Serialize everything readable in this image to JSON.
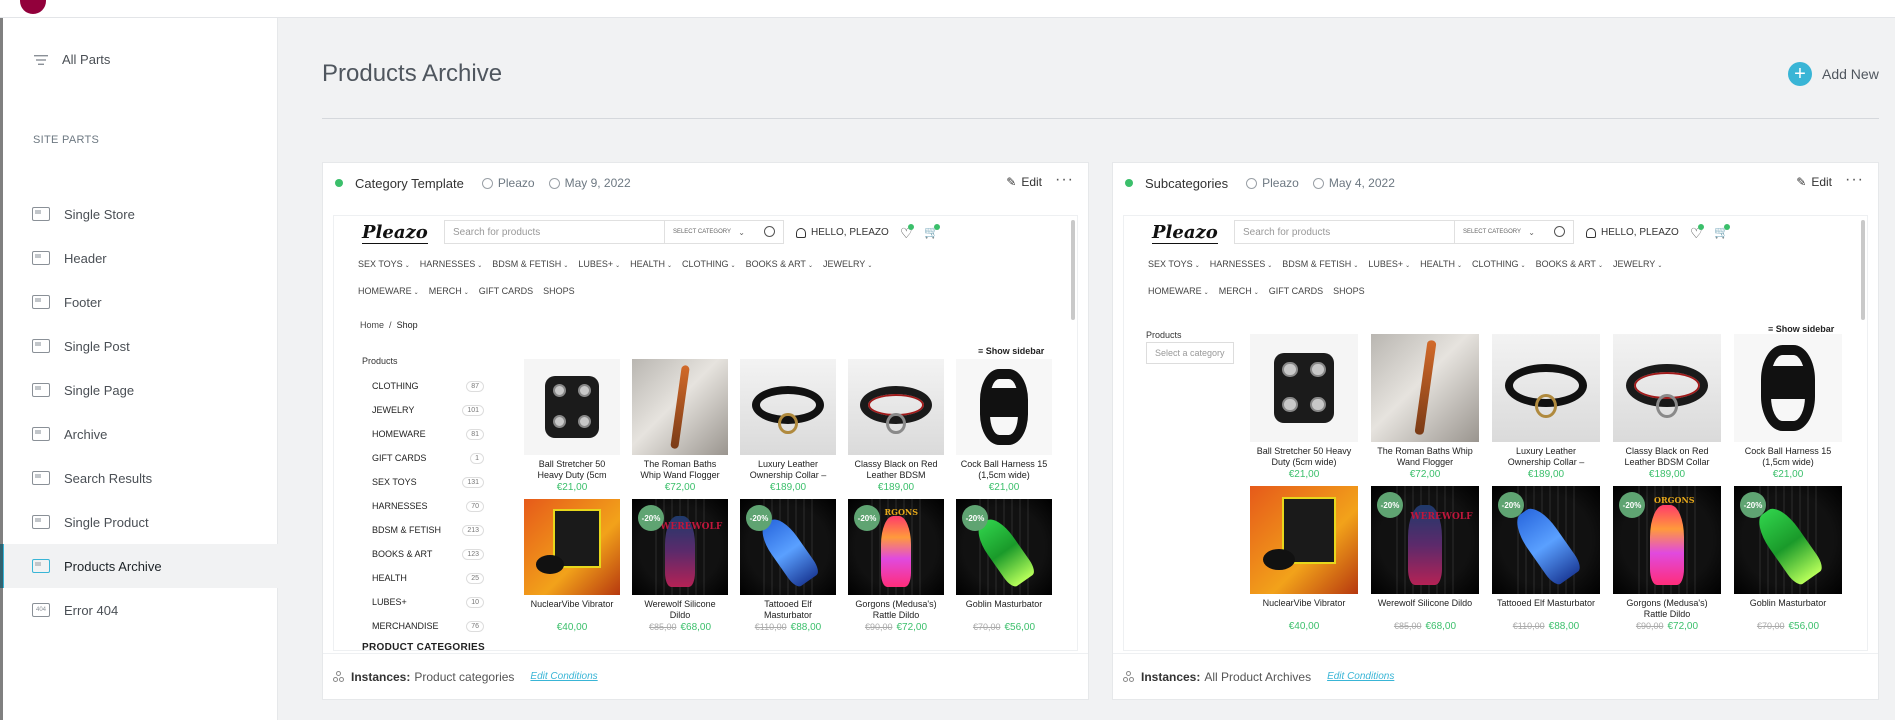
{
  "sidebar": {
    "all_parts": "All Parts",
    "site_parts_title": "SITE PARTS",
    "items": [
      {
        "label": "Single Store",
        "icon": "store-template-icon"
      },
      {
        "label": "Header",
        "icon": "header-template-icon"
      },
      {
        "label": "Footer",
        "icon": "footer-template-icon"
      },
      {
        "label": "Single Post",
        "icon": "single-post-icon"
      },
      {
        "label": "Single Page",
        "icon": "single-page-icon"
      },
      {
        "label": "Archive",
        "icon": "archive-icon"
      },
      {
        "label": "Search Results",
        "icon": "search-results-icon"
      },
      {
        "label": "Single Product",
        "icon": "single-product-icon"
      },
      {
        "label": "Products Archive",
        "icon": "products-archive-icon",
        "active": true
      },
      {
        "label": "Error 404",
        "icon": "error-404-icon",
        "icon_text": "404"
      }
    ]
  },
  "header": {
    "page_title": "Products Archive",
    "add_new": "Add New"
  },
  "store": {
    "logo": "Pleazo",
    "search_placeholder": "Search for products",
    "select_category": "SELECT CATEGORY",
    "hello": "HELLO, PLEAZO",
    "menu": [
      "SEX TOYS",
      "HARNESSES",
      "BDSM & FETISH",
      "LUBES+",
      "HEALTH",
      "CLOTHING",
      "BOOKS & ART",
      "JEWELRY",
      "HOMEWARE",
      "MERCH",
      "GIFT CARDS",
      "SHOPS"
    ],
    "show_sidebar": "Show sidebar",
    "products_label": "Products",
    "select_a_category": "Select a category",
    "breadcrumb_home": "Home",
    "breadcrumb_sep": "/",
    "breadcrumb_current": "Shop",
    "product_categories_title": "PRODUCT CATEGORIES",
    "categories": [
      {
        "name": "CLOTHING",
        "count": "87"
      },
      {
        "name": "JEWELRY",
        "count": "101"
      },
      {
        "name": "HOMEWARE",
        "count": "81"
      },
      {
        "name": "GIFT CARDS",
        "count": "1"
      },
      {
        "name": "SEX TOYS",
        "count": "131"
      },
      {
        "name": "HARNESSES",
        "count": "70"
      },
      {
        "name": "BDSM & FETISH",
        "count": "213"
      },
      {
        "name": "BOOKS & ART",
        "count": "123"
      },
      {
        "name": "HEALTH",
        "count": "25"
      },
      {
        "name": "LUBES+",
        "count": "10"
      },
      {
        "name": "MERCHANDISE",
        "count": "76"
      }
    ],
    "products_a": [
      {
        "name": "Ball Stretcher 50 Heavy Duty (5cm",
        "price": "€21,00",
        "old": "",
        "sale": "",
        "art": "cuff"
      },
      {
        "name": "The Roman Baths Whip Wand Flogger",
        "price": "€72,00",
        "old": "",
        "sale": "",
        "art": "wand"
      },
      {
        "name": "Luxury Leather Ownership Collar –",
        "price": "€189,00",
        "old": "",
        "sale": "",
        "art": "collar"
      },
      {
        "name": "Classy Black on Red Leather BDSM",
        "price": "€189,00",
        "old": "",
        "sale": "",
        "art": "collar-red"
      },
      {
        "name": "Cock Ball Harness 15 (1,5cm wide)",
        "price": "€21,00",
        "old": "",
        "sale": "",
        "art": "harness"
      },
      {
        "name": "NuclearVibe Vibrator",
        "price": "€40,00",
        "old": "",
        "sale": "",
        "art": "vibe"
      },
      {
        "name": "Werewolf Silicone Dildo",
        "price": "€68,00",
        "old": "€85,00",
        "sale": "-20%",
        "art": "werewolf",
        "label_text": "WEREWOLF"
      },
      {
        "name": "Tattooed Elf Masturbator",
        "price": "€88,00",
        "old": "€110,00",
        "sale": "-20%",
        "art": "blue"
      },
      {
        "name": "Gorgons (Medusa's) Rattle Dildo",
        "price": "€72,00",
        "old": "€90,00",
        "sale": "-20%",
        "art": "rainbow",
        "label_text": "RGONS"
      },
      {
        "name": "Goblin Masturbator",
        "price": "€56,00",
        "old": "€70,00",
        "sale": "-20%",
        "art": "green"
      }
    ],
    "products_b": [
      {
        "name": "Ball Stretcher 50 Heavy Duty (5cm wide)",
        "price": "€21,00",
        "old": "",
        "sale": "",
        "art": "cuff"
      },
      {
        "name": "The Roman Baths Whip Wand Flogger",
        "price": "€72,00",
        "old": "",
        "sale": "",
        "art": "wand"
      },
      {
        "name": "Luxury Leather Ownership Collar –",
        "price": "€189,00",
        "old": "",
        "sale": "",
        "art": "collar"
      },
      {
        "name": "Classy Black on Red Leather BDSM Collar",
        "price": "€189,00",
        "old": "",
        "sale": "",
        "art": "collar-red"
      },
      {
        "name": "Cock Ball Harness 15 (1,5cm wide)",
        "price": "€21,00",
        "old": "",
        "sale": "",
        "art": "harness"
      },
      {
        "name": "NuclearVibe Vibrator",
        "price": "€40,00",
        "old": "",
        "sale": "",
        "art": "vibe"
      },
      {
        "name": "Werewolf Silicone Dildo",
        "price": "€68,00",
        "old": "€85,00",
        "sale": "-20%",
        "art": "werewolf",
        "label_text": "WEREWOLF"
      },
      {
        "name": "Tattooed Elf Masturbator",
        "price": "€88,00",
        "old": "€110,00",
        "sale": "-20%",
        "art": "blue"
      },
      {
        "name": "Gorgons (Medusa's) Rattle Dildo",
        "price": "€72,00",
        "old": "€90,00",
        "sale": "-20%",
        "art": "rainbow",
        "label_text": "ORGONS"
      },
      {
        "name": "Goblin Masturbator",
        "price": "€56,00",
        "old": "€70,00",
        "sale": "-20%",
        "art": "green"
      }
    ]
  },
  "cards": [
    {
      "title": "Category Template",
      "author": "Pleazo",
      "date": "May 9, 2022",
      "edit": "Edit",
      "more": "···",
      "instances_label": "Instances:",
      "instances_value": "Product categories",
      "edit_conditions": "Edit Conditions"
    },
    {
      "title": "Subcategories",
      "author": "Pleazo",
      "date": "May 4, 2022",
      "edit": "Edit",
      "more": "···",
      "instances_label": "Instances:",
      "instances_value": "All Product Archives",
      "edit_conditions": "Edit Conditions"
    }
  ],
  "colors": {
    "accent": "#39b5d6",
    "status_green": "#3bbf6b",
    "sale_badge": "#5fa472",
    "brand": "#92003b"
  }
}
